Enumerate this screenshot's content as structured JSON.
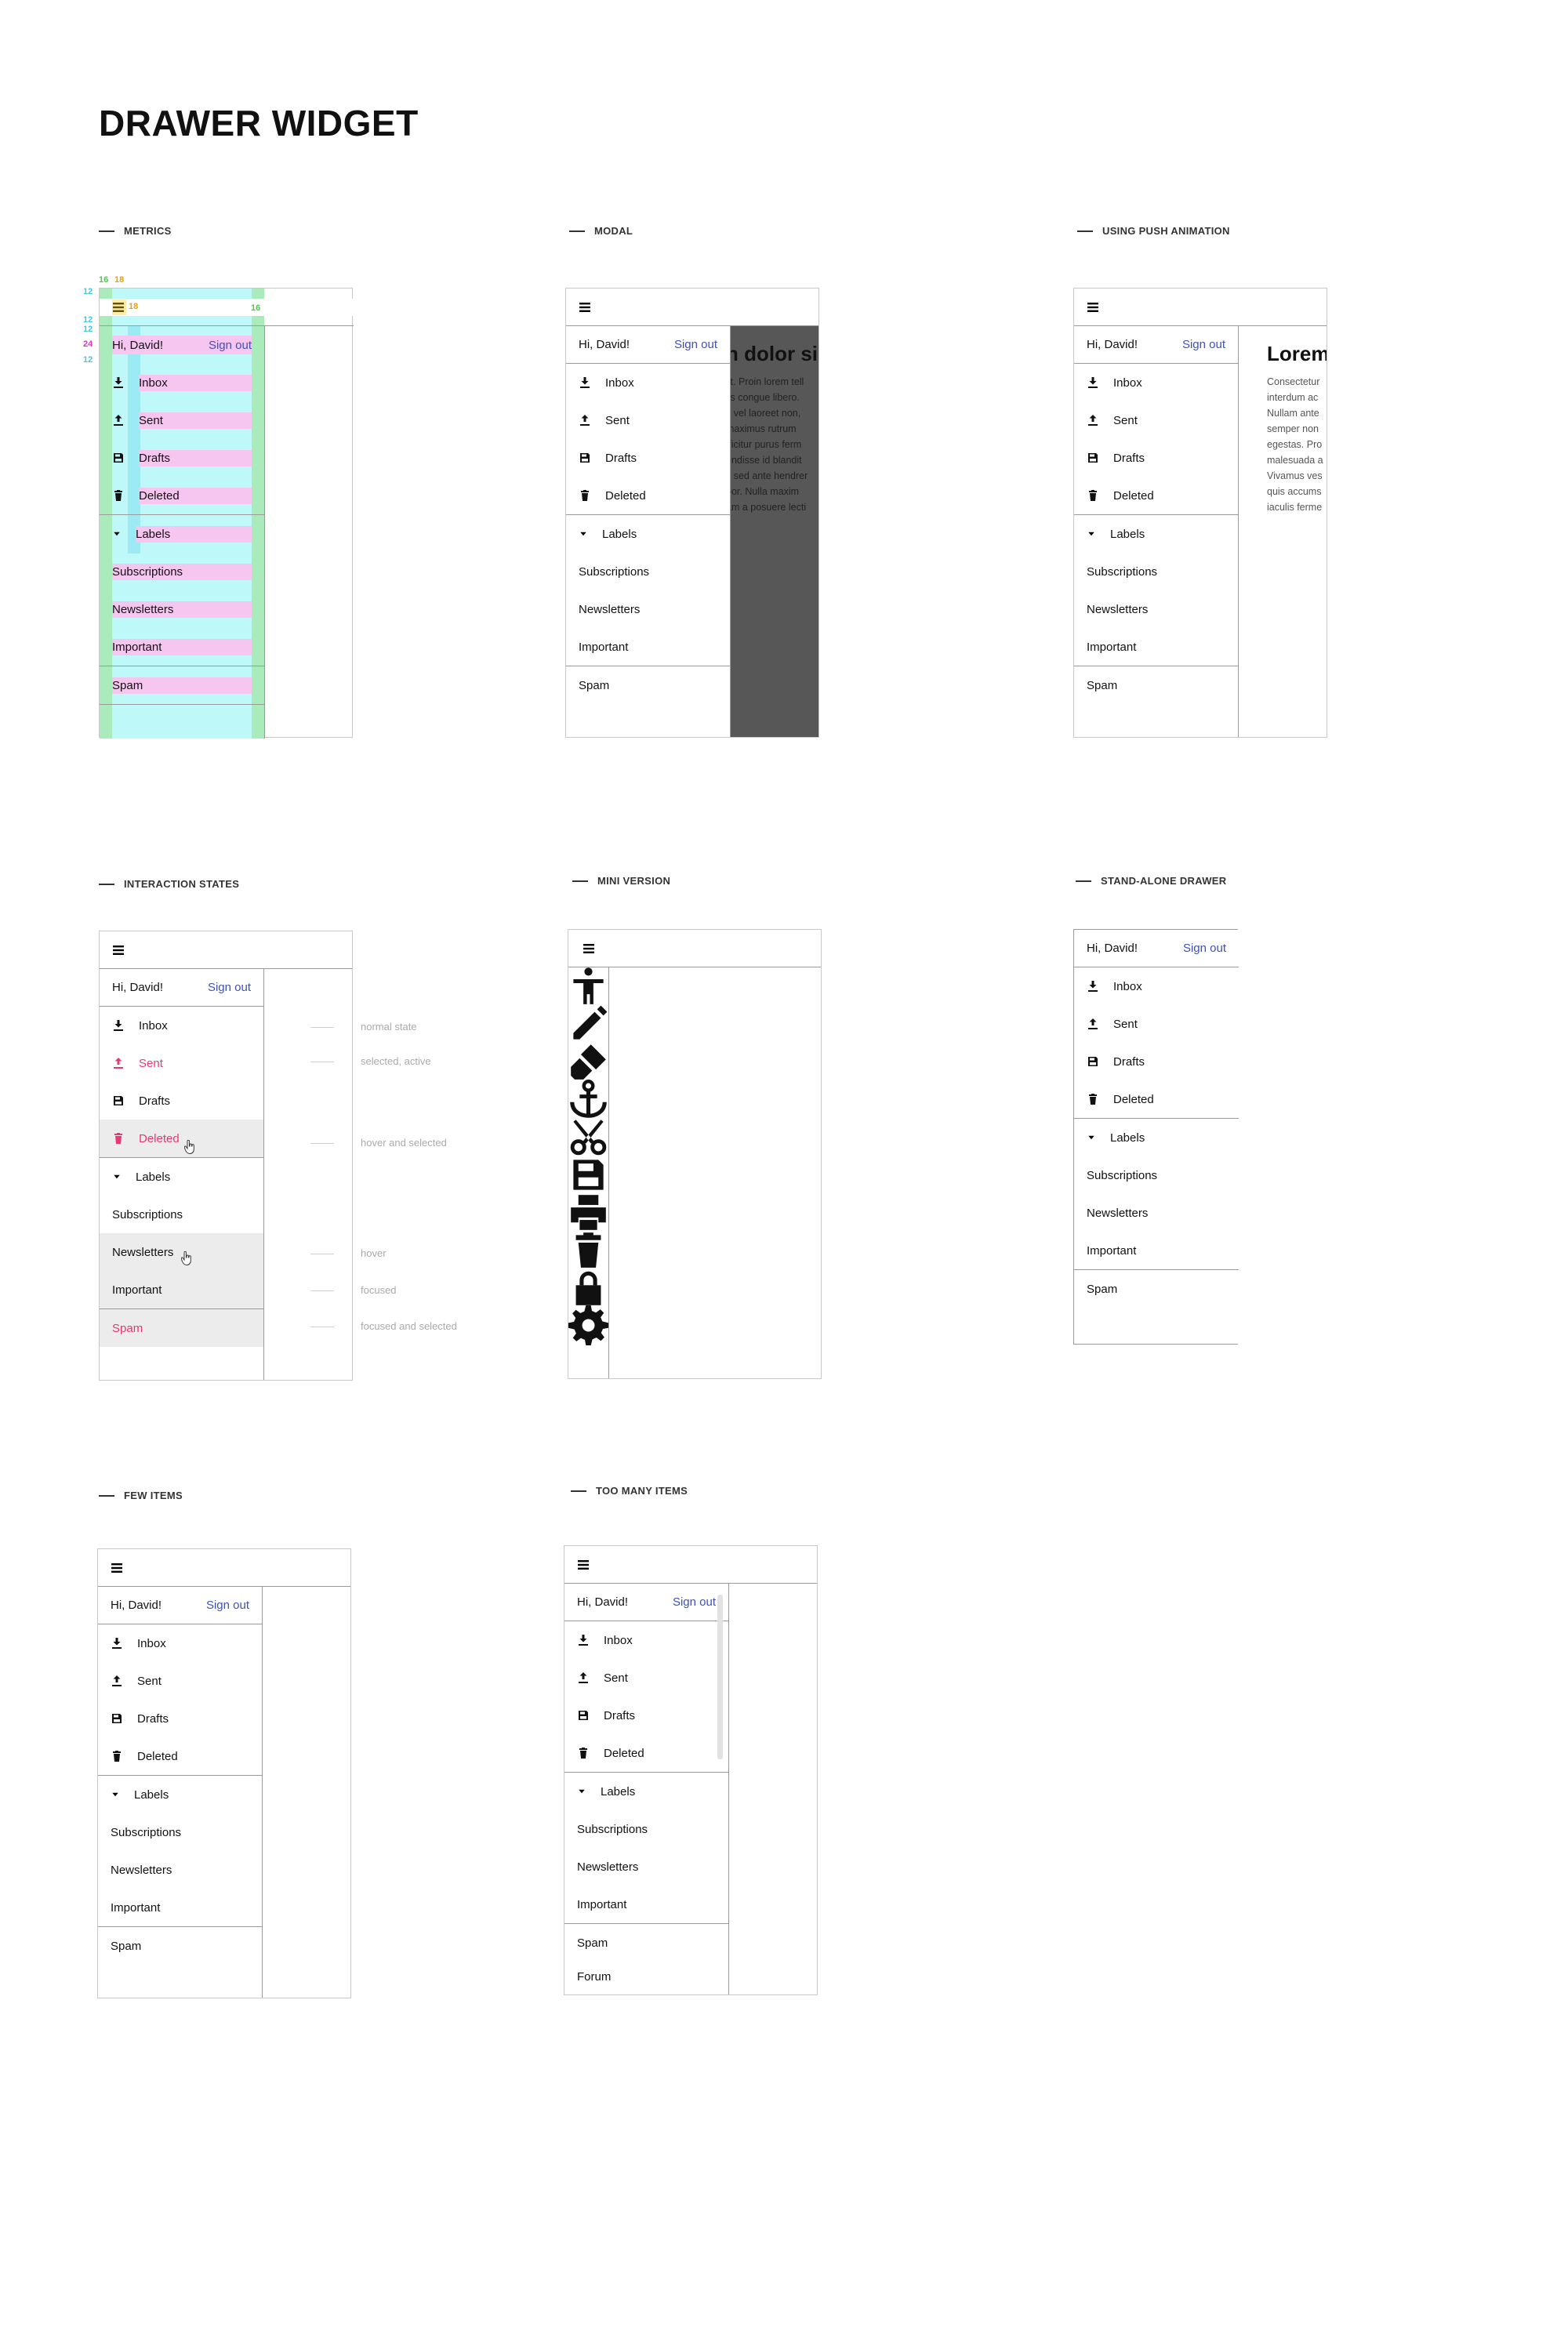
{
  "page": {
    "title": "DRAWER WIDGET"
  },
  "sections": {
    "metrics": "METRICS",
    "modal": "MODAL",
    "push": "USING PUSH ANIMATION",
    "states": "INTERACTION STATES",
    "mini": "MINI VERSION",
    "standalone": "STAND-ALONE DRAWER",
    "few": "FEW ITEMS",
    "many": "TOO MANY ITEMS"
  },
  "drawer": {
    "greeting": "Hi, David!",
    "signout": "Sign out",
    "items": [
      {
        "label": "Inbox",
        "icon": "download-icon"
      },
      {
        "label": "Sent",
        "icon": "upload-icon"
      },
      {
        "label": "Drafts",
        "icon": "save-icon"
      },
      {
        "label": "Deleted",
        "icon": "trash-icon"
      }
    ],
    "labels_header": "Labels",
    "labels": [
      "Subscriptions",
      "Newsletters",
      "Important"
    ],
    "spam": "Spam",
    "forum": "Forum"
  },
  "content": {
    "title": "Lorem",
    "para": [
      "Consectetur",
      "interdum ac",
      "Nullam ante",
      "semper non",
      "egestas. Pro",
      "malesuada a",
      "Vivamus ves",
      "quis accums",
      "iaculis ferme"
    ],
    "modal_title": "n dolor si",
    "modal_para": [
      "lit. Proin lorem tell",
      "lis congue libero.",
      "s vel laoreet non,",
      "maximus rutrum",
      "fficitur purus ferm",
      "endisse id blandit",
      "s sed ante hendrer",
      "por. Nulla maxim",
      "am a posuere lecti"
    ]
  },
  "states": {
    "normal": "normal state",
    "selected": "selected, active",
    "hover_selected": "hover and selected",
    "hover": "hover",
    "focused": "focused",
    "focused_selected": "focused and selected"
  },
  "mini_icons": [
    "accessibility-icon",
    "pencil-icon",
    "brush-icon",
    "anchor-icon",
    "scissors-icon",
    "save-icon",
    "print-icon",
    "trash-icon",
    "lock-icon",
    "gear-icon"
  ],
  "metrics": {
    "n16": "16",
    "n18": "18",
    "n12": "12",
    "n24": "24"
  },
  "colors": {
    "accent": "#3f51b5",
    "selected": "#e53978",
    "hover_bg": "#ececec",
    "overlay": "#575757"
  }
}
